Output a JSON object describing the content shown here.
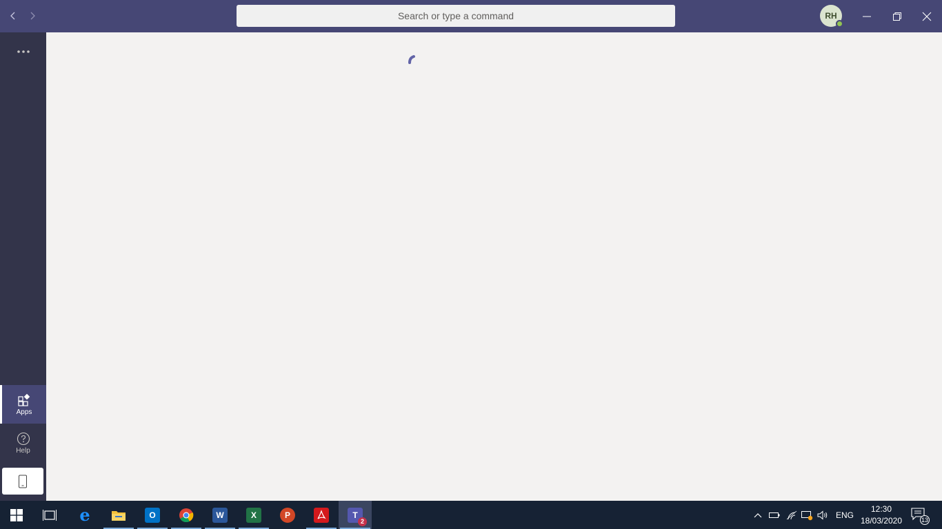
{
  "titlebar": {
    "search_placeholder": "Search or type a command",
    "avatar_initials": "RH",
    "presence_color": "#92c353",
    "bar_color": "#464775"
  },
  "rail": {
    "apps_label": "Apps",
    "help_label": "Help"
  },
  "main": {
    "state": "loading"
  },
  "taskbar": {
    "apps": [
      {
        "name": "task-view",
        "icon": "task-view-icon"
      },
      {
        "name": "edge",
        "icon": "edge-icon"
      },
      {
        "name": "file-explorer",
        "icon": "folder-icon"
      },
      {
        "name": "outlook",
        "icon": "outlook-icon",
        "letter": "O"
      },
      {
        "name": "chrome",
        "icon": "chrome-icon"
      },
      {
        "name": "word",
        "icon": "word-icon",
        "letter": "W"
      },
      {
        "name": "excel",
        "icon": "excel-icon",
        "letter": "X"
      },
      {
        "name": "powerpoint",
        "icon": "powerpoint-icon",
        "letter": "P"
      },
      {
        "name": "acrobat",
        "icon": "acrobat-icon"
      },
      {
        "name": "teams",
        "icon": "teams-icon",
        "letter": "T",
        "badge": "2"
      }
    ],
    "language": "ENG",
    "time": "12:30",
    "date": "18/03/2020",
    "notification_count": "13"
  }
}
